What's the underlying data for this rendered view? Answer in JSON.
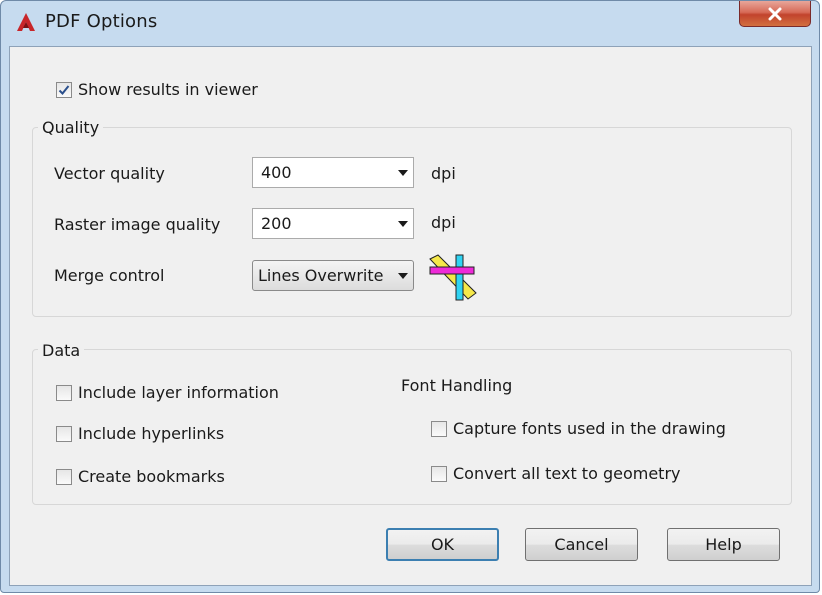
{
  "window": {
    "title": "PDF Options",
    "app_icon": "autocad-a-icon",
    "close_icon": "close-x-icon"
  },
  "show_results": {
    "label": "Show results in viewer",
    "checked": true
  },
  "quality": {
    "group_label": "Quality",
    "vector": {
      "label": "Vector quality",
      "value": "400",
      "unit": "dpi"
    },
    "raster": {
      "label": "Raster image quality",
      "value": "200",
      "unit": "dpi"
    },
    "merge": {
      "label": "Merge control",
      "value": "Lines Overwrite",
      "preview_icon": "lines-overwrite-preview-icon"
    }
  },
  "data": {
    "group_label": "Data",
    "layer_info": {
      "label": "Include layer information",
      "checked": false
    },
    "hyperlinks": {
      "label": "Include hyperlinks",
      "checked": false
    },
    "bookmarks": {
      "label": "Create bookmarks",
      "checked": false
    },
    "font_handling": {
      "label": "Font Handling",
      "capture_fonts": {
        "label": "Capture fonts used in the drawing",
        "checked": false
      },
      "convert_text": {
        "label": "Convert all text to geometry",
        "checked": false
      }
    }
  },
  "buttons": {
    "ok": "OK",
    "cancel": "Cancel",
    "help": "Help"
  },
  "colors": {
    "window_frame": "#c6dbef",
    "client_bg": "#f0f0f0",
    "close_red": "#c2432d",
    "default_button_border": "#3c7fb1"
  }
}
